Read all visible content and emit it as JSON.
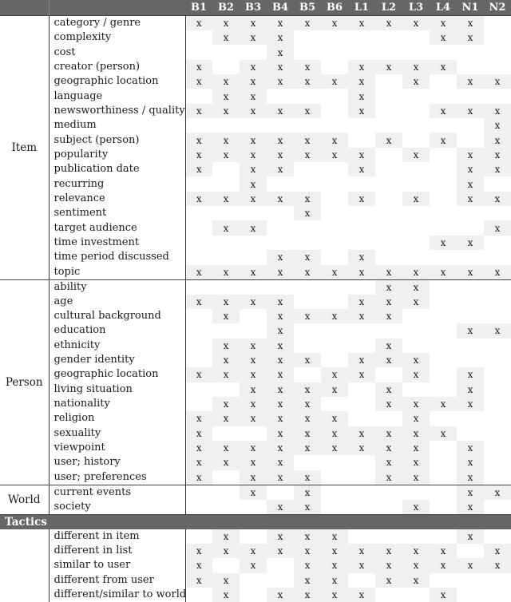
{
  "table": {
    "columns": [
      "B1",
      "B2",
      "B3",
      "B4",
      "B5",
      "B6",
      "L1",
      "L2",
      "L3",
      "L4",
      "N1",
      "N2"
    ],
    "mark": "x",
    "colors": {
      "header_bg": "#666666",
      "header_text": "#ffffff",
      "marked_cell_bg": "#f0f0f0"
    },
    "sections": [
      {
        "group": "Item",
        "rows": [
          {
            "label": "category / genre",
            "marks": [
              "B1",
              "B2",
              "B3",
              "B4",
              "B5",
              "B6",
              "L1",
              "L2",
              "L3",
              "L4",
              "N1"
            ]
          },
          {
            "label": "complexity",
            "marks": [
              "B2",
              "B3",
              "B4",
              "L4",
              "N1"
            ]
          },
          {
            "label": "cost",
            "marks": [
              "B4"
            ]
          },
          {
            "label": "creator (person)",
            "marks": [
              "B1",
              "B3",
              "B4",
              "B5",
              "L1",
              "L2",
              "L3",
              "L4"
            ]
          },
          {
            "label": "geographic location",
            "marks": [
              "B1",
              "B2",
              "B3",
              "B4",
              "B5",
              "B6",
              "L1",
              "L3",
              "N1",
              "N2"
            ]
          },
          {
            "label": "language",
            "marks": [
              "B2",
              "B3",
              "L1"
            ]
          },
          {
            "label": "newsworthiness / quality",
            "marks": [
              "B1",
              "B2",
              "B3",
              "B4",
              "B5",
              "L1",
              "L4",
              "N1",
              "N2"
            ]
          },
          {
            "label": "medium",
            "marks": [
              "N2"
            ]
          },
          {
            "label": "subject (person)",
            "marks": [
              "B1",
              "B2",
              "B3",
              "B4",
              "B5",
              "B6",
              "L2",
              "L4",
              "N2"
            ]
          },
          {
            "label": "popularity",
            "marks": [
              "B1",
              "B2",
              "B3",
              "B4",
              "B5",
              "B6",
              "L1",
              "L3",
              "N1",
              "N2"
            ]
          },
          {
            "label": "publication date",
            "marks": [
              "B1",
              "B3",
              "B4",
              "L1",
              "N1",
              "N2"
            ]
          },
          {
            "label": "recurring",
            "marks": [
              "B3",
              "N1"
            ]
          },
          {
            "label": "relevance",
            "marks": [
              "B1",
              "B2",
              "B3",
              "B4",
              "B5",
              "L1",
              "L3",
              "N1",
              "N2"
            ]
          },
          {
            "label": "sentiment",
            "marks": [
              "B5"
            ]
          },
          {
            "label": "target audience",
            "marks": [
              "B2",
              "B3",
              "N2"
            ]
          },
          {
            "label": "time investment",
            "marks": [
              "L4",
              "N1"
            ]
          },
          {
            "label": "time period discussed",
            "marks": [
              "B4",
              "B5",
              "L1"
            ]
          },
          {
            "label": "topic",
            "marks": [
              "B1",
              "B2",
              "B3",
              "B4",
              "B5",
              "B6",
              "L1",
              "L2",
              "L3",
              "L4",
              "N1",
              "N2"
            ]
          }
        ]
      },
      {
        "group": "Person",
        "rows": [
          {
            "label": "ability",
            "marks": [
              "L2",
              "L3"
            ]
          },
          {
            "label": "age",
            "marks": [
              "B1",
              "B2",
              "B3",
              "B4",
              "L1",
              "L2",
              "L3"
            ]
          },
          {
            "label": "cultural background",
            "marks": [
              "B2",
              "B4",
              "B5",
              "B6",
              "L1",
              "L2"
            ]
          },
          {
            "label": "education",
            "marks": [
              "B4",
              "N1",
              "N2"
            ]
          },
          {
            "label": "ethnicity",
            "marks": [
              "B2",
              "B3",
              "B4",
              "L2"
            ]
          },
          {
            "label": "gender identity",
            "marks": [
              "B2",
              "B3",
              "B4",
              "B5",
              "L1",
              "L2",
              "L3"
            ]
          },
          {
            "label": "geographic location",
            "marks": [
              "B1",
              "B2",
              "B3",
              "B4",
              "B6",
              "L1",
              "L3",
              "N1"
            ]
          },
          {
            "label": "living situation",
            "marks": [
              "B3",
              "B4",
              "B5",
              "B6",
              "L2",
              "N1"
            ]
          },
          {
            "label": "nationality",
            "marks": [
              "B2",
              "B3",
              "B4",
              "B5",
              "L2",
              "L3",
              "L4",
              "N1"
            ]
          },
          {
            "label": "religion",
            "marks": [
              "B1",
              "B2",
              "B3",
              "B4",
              "B5",
              "B6",
              "L3"
            ]
          },
          {
            "label": "sexuality",
            "marks": [
              "B1",
              "B4",
              "B5",
              "B6",
              "L1",
              "L2",
              "L3",
              "L4"
            ]
          },
          {
            "label": "viewpoint",
            "marks": [
              "B1",
              "B2",
              "B3",
              "B4",
              "B5",
              "B6",
              "L1",
              "L2",
              "L3",
              "N1"
            ]
          },
          {
            "label": "user; history",
            "marks": [
              "B1",
              "B2",
              "B3",
              "B4",
              "L2",
              "L3",
              "N1"
            ]
          },
          {
            "label": "user; preferences",
            "marks": [
              "B1",
              "B3",
              "B4",
              "B5",
              "L2",
              "L3",
              "N1"
            ]
          }
        ]
      },
      {
        "group": "World",
        "rows": [
          {
            "label": "current events",
            "marks": [
              "B3",
              "B5",
              "N1",
              "N2"
            ]
          },
          {
            "label": "society",
            "marks": [
              "B4",
              "B5",
              "L3",
              "N1"
            ]
          }
        ]
      },
      {
        "group": "Tactics",
        "as_bar": true,
        "rows": [
          {
            "label": "different in item",
            "marks": [
              "B2",
              "B4",
              "B5",
              "B6",
              "N1"
            ]
          },
          {
            "label": "different in list",
            "marks": [
              "B1",
              "B2",
              "B3",
              "B4",
              "B5",
              "B6",
              "L1",
              "L2",
              "L3",
              "L4",
              "N2"
            ]
          },
          {
            "label": "similar to user",
            "marks": [
              "B1",
              "B3",
              "B5",
              "B6",
              "L1",
              "L2",
              "L3",
              "L4",
              "N1",
              "N2"
            ]
          },
          {
            "label": "different from user",
            "marks": [
              "B1",
              "B2",
              "B5",
              "B6",
              "L2",
              "L3"
            ]
          },
          {
            "label": "different/similar to world",
            "marks": [
              "B2",
              "B4",
              "B5",
              "B6",
              "L1",
              "L4"
            ]
          }
        ]
      }
    ]
  }
}
